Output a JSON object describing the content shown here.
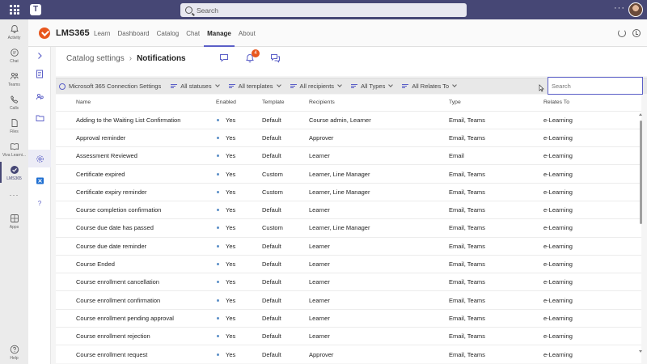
{
  "topbar": {
    "search_placeholder": "Search",
    "more": "···"
  },
  "rail": {
    "items": [
      {
        "label": "Activity",
        "icon": "bell-icon"
      },
      {
        "label": "Chat",
        "icon": "chat-icon"
      },
      {
        "label": "Teams",
        "icon": "teams-icon"
      },
      {
        "label": "Calls",
        "icon": "phone-icon"
      },
      {
        "label": "Files",
        "icon": "file-icon"
      },
      {
        "label": "Viva Learni...",
        "icon": "book-icon"
      },
      {
        "label": "LMS365",
        "icon": "lms365-icon"
      },
      {
        "label": "Apps",
        "icon": "apps-icon"
      },
      {
        "label": "Help",
        "icon": "help-icon"
      }
    ],
    "more": "···"
  },
  "app": {
    "name": "LMS365",
    "tabs": [
      "Learn",
      "Dashboard",
      "Catalog",
      "Chat",
      "Manage",
      "About"
    ],
    "active_tab": "Manage"
  },
  "breadcrumb": {
    "parent": "Catalog settings",
    "current": "Notifications"
  },
  "header_icons": {
    "notification_count": "4"
  },
  "filters": {
    "connection": "Microsoft 365 Connection Settings",
    "statuses": "All statuses",
    "templates": "All templates",
    "recipients": "All recipients",
    "types": "All Types",
    "relates_to": "All Relates To",
    "search_placeholder": "Search"
  },
  "table": {
    "columns": [
      "Name",
      "Enabled",
      "Template",
      "Recipients",
      "Type",
      "Relates To"
    ],
    "rows": [
      [
        "Adding to the Waiting List Confirmation",
        "Yes",
        "Default",
        "Course admin, Learner",
        "Email, Teams",
        "e-Learning"
      ],
      [
        "Approval reminder",
        "Yes",
        "Default",
        "Approver",
        "Email, Teams",
        "e-Learning"
      ],
      [
        "Assessment Reviewed",
        "Yes",
        "Default",
        "Learner",
        "Email",
        "e-Learning"
      ],
      [
        "Certificate expired",
        "Yes",
        "Custom",
        "Learner, Line Manager",
        "Email, Teams",
        "e-Learning"
      ],
      [
        "Certificate expiry reminder",
        "Yes",
        "Custom",
        "Learner, Line Manager",
        "Email, Teams",
        "e-Learning"
      ],
      [
        "Course completion confirmation",
        "Yes",
        "Default",
        "Learner",
        "Email, Teams",
        "e-Learning"
      ],
      [
        "Course due date has passed",
        "Yes",
        "Custom",
        "Learner, Line Manager",
        "Email, Teams",
        "e-Learning"
      ],
      [
        "Course due date reminder",
        "Yes",
        "Default",
        "Learner",
        "Email, Teams",
        "e-Learning"
      ],
      [
        "Course Ended",
        "Yes",
        "Default",
        "Learner",
        "Email, Teams",
        "e-Learning"
      ],
      [
        "Course enrollment cancellation",
        "Yes",
        "Default",
        "Learner",
        "Email, Teams",
        "e-Learning"
      ],
      [
        "Course enrollment confirmation",
        "Yes",
        "Default",
        "Learner",
        "Email, Teams",
        "e-Learning"
      ],
      [
        "Course enrollment pending approval",
        "Yes",
        "Default",
        "Learner",
        "Email, Teams",
        "e-Learning"
      ],
      [
        "Course enrollment rejection",
        "Yes",
        "Default",
        "Learner",
        "Email, Teams",
        "e-Learning"
      ],
      [
        "Course enrollment request",
        "Yes",
        "Default",
        "Approver",
        "Email, Teams",
        "e-Learning"
      ]
    ]
  },
  "colors": {
    "teams_purple": "#464775",
    "accent": "#5b5fc7",
    "brand_orange": "#e8571e"
  }
}
